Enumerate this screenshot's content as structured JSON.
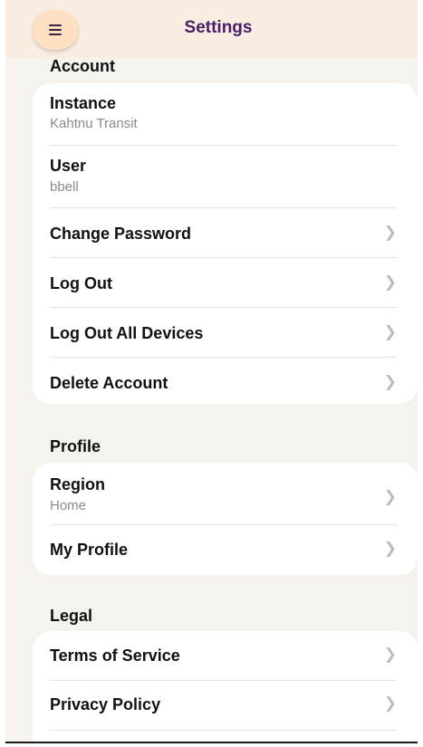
{
  "header": {
    "title": "Settings",
    "menu_icon": "hamburger-menu-icon"
  },
  "sections": {
    "account": {
      "title": "Account",
      "instance": {
        "label": "Instance",
        "value": "Kahtnu Transit"
      },
      "user": {
        "label": "User",
        "value": "bbell"
      },
      "change_password": "Change Password",
      "log_out": "Log Out",
      "log_out_all": "Log Out All Devices",
      "delete_account": "Delete Account"
    },
    "profile": {
      "title": "Profile",
      "region": {
        "label": "Region",
        "value": "Home"
      },
      "my_profile": "My Profile"
    },
    "legal": {
      "title": "Legal",
      "terms": "Terms of Service",
      "privacy": "Privacy Policy"
    }
  },
  "icons": {
    "chevron": "chevron-right-icon"
  },
  "colors": {
    "header_bg": "#faeee2",
    "menu_button_bg": "#fde1c2",
    "title_color": "#4a1e64",
    "page_bg": "#f6f2ee",
    "card_bg": "#ffffff",
    "chevron": "#bdbdbd",
    "subtitle": "#8a8a8a"
  }
}
